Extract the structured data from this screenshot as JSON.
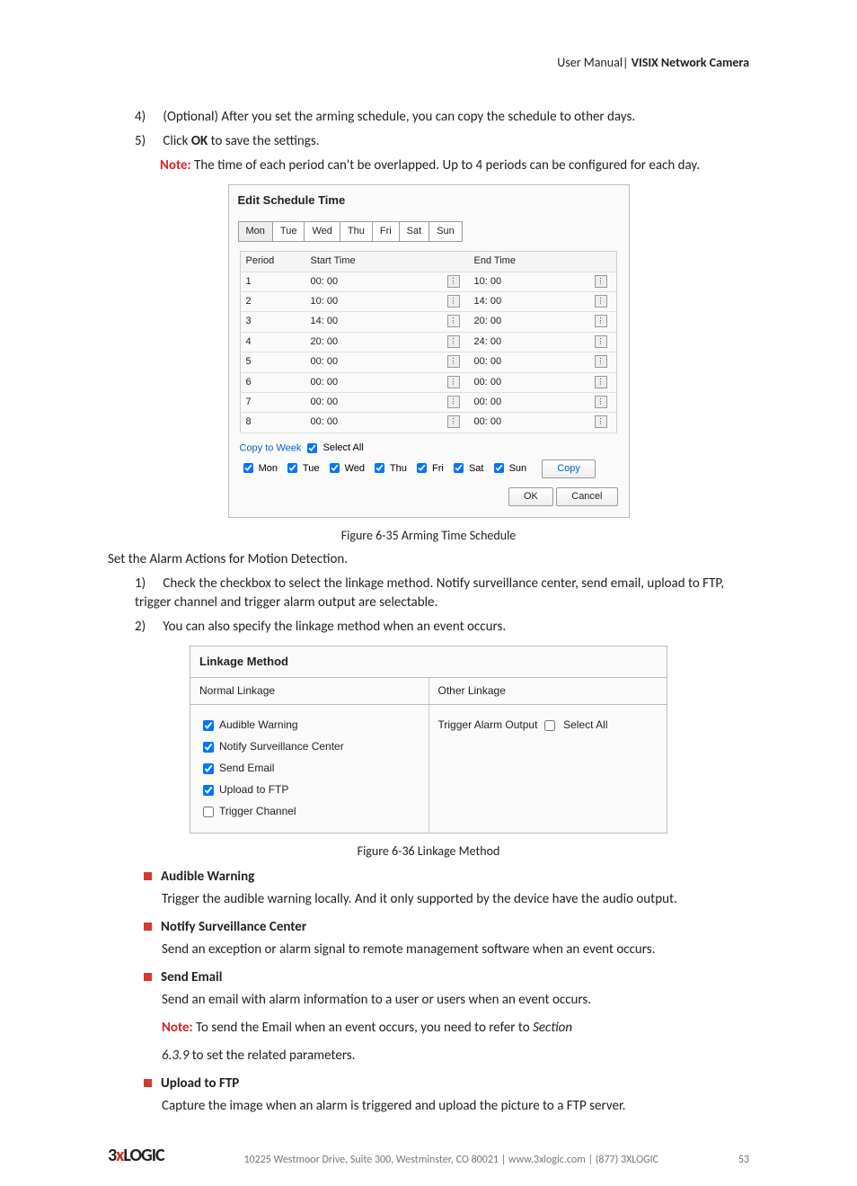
{
  "header": {
    "left": "User Manual|",
    "right": "VISIX Network Camera"
  },
  "steps_top": [
    {
      "num": "4)",
      "text": "(Optional) After you set the arming schedule, you can copy the schedule to other days."
    },
    {
      "num": "5)",
      "text_pre": "Click ",
      "bold": "OK",
      "text_post": " to save the settings."
    }
  ],
  "note_top": {
    "label": "Note:",
    "text": " The time of each period can't be overlapped. Up to 4 periods can be configured for each day."
  },
  "fig1": {
    "title": "Edit Schedule Time",
    "days": [
      "Mon",
      "Tue",
      "Wed",
      "Thu",
      "Fri",
      "Sat",
      "Sun"
    ],
    "active_day_index": 0,
    "headers": {
      "period": "Period",
      "start": "Start Time",
      "end": "End Time"
    },
    "rows": [
      {
        "p": "1",
        "s": "00: 00",
        "e": "10: 00"
      },
      {
        "p": "2",
        "s": "10: 00",
        "e": "14: 00"
      },
      {
        "p": "3",
        "s": "14: 00",
        "e": "20: 00"
      },
      {
        "p": "4",
        "s": "20: 00",
        "e": "24: 00"
      },
      {
        "p": "5",
        "s": "00: 00",
        "e": "00: 00"
      },
      {
        "p": "6",
        "s": "00: 00",
        "e": "00: 00"
      },
      {
        "p": "7",
        "s": "00: 00",
        "e": "00: 00"
      },
      {
        "p": "8",
        "s": "00: 00",
        "e": "00: 00"
      }
    ],
    "copy_label": "Copy to Week",
    "select_all": "Select All",
    "copy_days": [
      {
        "d": "Mon",
        "c": true
      },
      {
        "d": "Tue",
        "c": true
      },
      {
        "d": "Wed",
        "c": true
      },
      {
        "d": "Thu",
        "c": true
      },
      {
        "d": "Fri",
        "c": true
      },
      {
        "d": "Sat",
        "c": true
      },
      {
        "d": "Sun",
        "c": true
      }
    ],
    "btn_copy": "Copy",
    "btn_ok": "OK",
    "btn_cancel": "Cancel",
    "caption": "Figure 6-35 Arming Time Schedule"
  },
  "mid_text": {
    "set_alarm": "Set the Alarm Actions for Motion Detection.",
    "list": [
      {
        "num": "1)",
        "text": "Check the checkbox to select the linkage method. Notify surveillance center, send email, upload to FTP, trigger channel and trigger alarm output are selectable."
      },
      {
        "num": "2)",
        "text": "You can also specify the linkage method when an event occurs."
      }
    ]
  },
  "fig2": {
    "title": "Linkage Method",
    "col1_header": "Normal Linkage",
    "col2_header": "Other Linkage",
    "normal": [
      {
        "label": "Audible Warning",
        "checked": true
      },
      {
        "label": "Notify Surveillance Center",
        "checked": true
      },
      {
        "label": "Send Email",
        "checked": true
      },
      {
        "label": "Upload to FTP",
        "checked": true
      },
      {
        "label": "Trigger Channel",
        "checked": false
      }
    ],
    "other": {
      "label": "Trigger Alarm Output",
      "select_all": "Select All",
      "checked": false
    },
    "caption": "Figure 6-36 Linkage Method"
  },
  "sections": [
    {
      "title": "Audible Warning",
      "body": "Trigger the audible warning locally. And it only supported by the device have the audio output."
    },
    {
      "title": "Notify Surveillance Center",
      "body": "Send an exception or alarm signal to remote management software when an event occurs."
    },
    {
      "title": "Send Email",
      "body": "Send an email with alarm information to a user or users when an event occurs.",
      "note_label": "Note:",
      "note_text": " To send the Email when an event occurs, you need to refer to ",
      "note_italic": "Section",
      "extra": "6.3.9  to set the related parameters."
    },
    {
      "title": "Upload to FTP",
      "body": "Capture the image when an alarm is triggered and upload the picture to a FTP server."
    }
  ],
  "footer": {
    "logo_pre": "3",
    "logo_x": "x",
    "logo_post": "LOGIC",
    "addr": "10225 Westmoor Drive, Suite 300, Westminster, CO 80021 | www.3xlogic.com | (877) 3XLOGIC",
    "page": "53"
  }
}
